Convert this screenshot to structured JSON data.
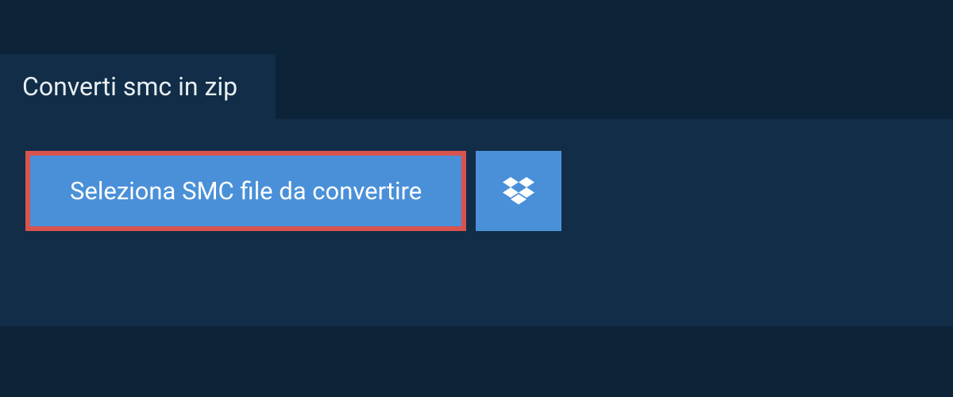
{
  "tab": {
    "label": "Converti smc in zip"
  },
  "actions": {
    "select_file_label": "Seleziona SMC file da convertire",
    "dropbox_icon": "dropbox-icon"
  },
  "colors": {
    "background": "#0d2338",
    "panel": "#112d47",
    "button": "#4a90d9",
    "highlight_border": "#d9534f",
    "text_light": "#e8eef3",
    "text_white": "#ffffff"
  }
}
